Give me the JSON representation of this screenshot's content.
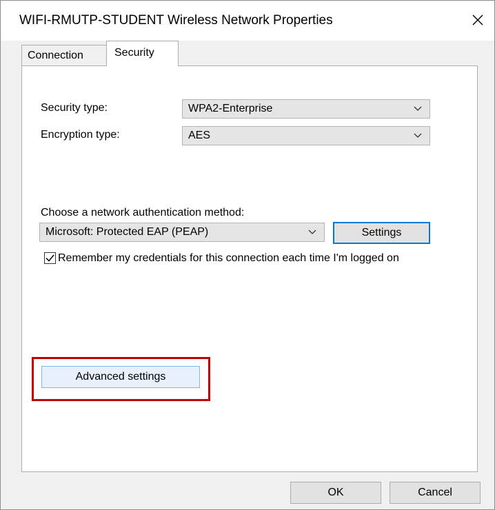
{
  "window": {
    "title": "WIFI-RMUTP-STUDENT Wireless Network Properties",
    "close_glyph": "✕"
  },
  "tabs": [
    {
      "label": "Connection",
      "active": false
    },
    {
      "label": "Security",
      "active": true
    }
  ],
  "security": {
    "security_type_label": "Security type:",
    "security_type_value": "WPA2-Enterprise",
    "encryption_type_label": "Encryption type:",
    "encryption_type_value": "AES",
    "auth_method_label": "Choose a network authentication method:",
    "auth_method_value": "Microsoft: Protected EAP (PEAP)",
    "settings_button": "Settings",
    "remember_checkbox_checked": true,
    "remember_label": "Remember my credentials for this connection each time I'm logged on",
    "advanced_button": "Advanced settings"
  },
  "footer": {
    "ok_button": "OK",
    "cancel_button": "Cancel"
  },
  "colors": {
    "highlight": "#c00000",
    "focus_border": "#0078d7"
  },
  "icons": {
    "close": "close-icon",
    "dropdown": "chevron-down-icon",
    "check": "checkmark-icon"
  }
}
